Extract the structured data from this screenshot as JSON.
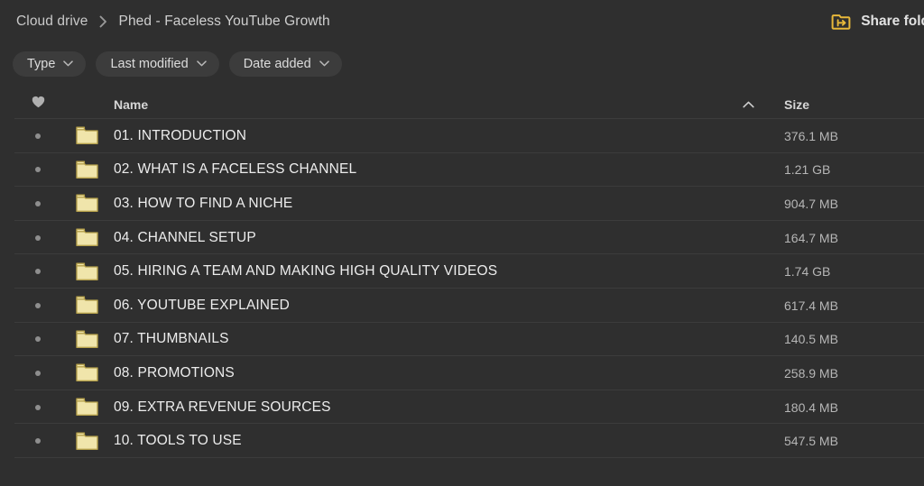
{
  "breadcrumb": {
    "root": "Cloud drive",
    "separator_icon": "chevron-right-icon",
    "current": "Phed - Faceless YouTube Growth"
  },
  "share": {
    "label": "Share fold",
    "full_label": "Share folder",
    "icon": "share-folder-icon",
    "icon_color": "#e8b83a"
  },
  "filters": [
    {
      "label": "Type",
      "icon": "chevron-down-icon"
    },
    {
      "label": "Last modified",
      "icon": "chevron-down-icon"
    },
    {
      "label": "Date added",
      "icon": "chevron-down-icon"
    }
  ],
  "table": {
    "headers": {
      "favorite_icon": "heart-icon",
      "name": "Name",
      "sort_icon": "chevron-up-icon",
      "size": "Size"
    },
    "rows": [
      {
        "favorite_icon": "dot-icon",
        "icon": "folder-icon",
        "name": "01. INTRODUCTION",
        "size": "376.1 MB"
      },
      {
        "favorite_icon": "dot-icon",
        "icon": "folder-icon",
        "name": "02. WHAT IS A FACELESS CHANNEL",
        "size": "1.21 GB"
      },
      {
        "favorite_icon": "dot-icon",
        "icon": "folder-icon",
        "name": "03. HOW TO FIND A NICHE",
        "size": "904.7 MB"
      },
      {
        "favorite_icon": "dot-icon",
        "icon": "folder-icon",
        "name": "04. CHANNEL SETUP",
        "size": "164.7 MB"
      },
      {
        "favorite_icon": "dot-icon",
        "icon": "folder-icon",
        "name": "05. HIRING A TEAM AND MAKING HIGH QUALITY VIDEOS",
        "size": "1.74 GB"
      },
      {
        "favorite_icon": "dot-icon",
        "icon": "folder-icon",
        "name": "06. YOUTUBE EXPLAINED",
        "size": "617.4 MB"
      },
      {
        "favorite_icon": "dot-icon",
        "icon": "folder-icon",
        "name": "07. THUMBNAILS",
        "size": "140.5 MB"
      },
      {
        "favorite_icon": "dot-icon",
        "icon": "folder-icon",
        "name": "08. PROMOTIONS",
        "size": "258.9 MB"
      },
      {
        "favorite_icon": "dot-icon",
        "icon": "folder-icon",
        "name": "09. EXTRA REVENUE SOURCES",
        "size": "180.4 MB"
      },
      {
        "favorite_icon": "dot-icon",
        "icon": "folder-icon",
        "name": "10. TOOLS TO USE",
        "size": "547.5 MB"
      }
    ]
  },
  "colors": {
    "background": "#2f2f2f",
    "pill": "#3c3c3c",
    "divider": "#3c3c3c",
    "folder_fill": "#f0e5ab",
    "folder_border": "#b5a04a",
    "accent": "#e8b83a",
    "text_primary": "#ededed",
    "text_secondary": "#b6b6b6"
  }
}
